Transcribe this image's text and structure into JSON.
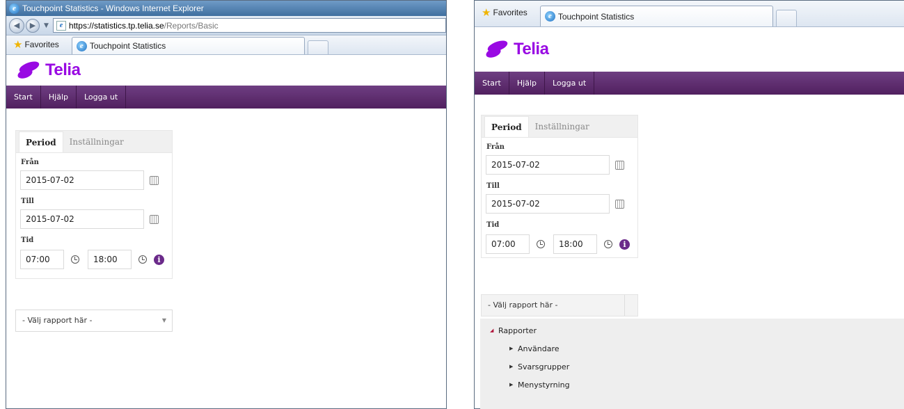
{
  "left_window": {
    "title": "Touchpoint Statistics - Windows Internet Explorer",
    "url_host": "https://statistics.tp.telia.se",
    "url_path": "/Reports/Basic",
    "favorites_label": "Favorites",
    "tab_label": "Touchpoint Statistics"
  },
  "right_window": {
    "favorites_label": "Favorites",
    "tab_label": "Touchpoint Statistics"
  },
  "app": {
    "logo_text": "Telia",
    "nav": [
      "Start",
      "Hjälp",
      "Logga ut"
    ],
    "tabs": {
      "period": "Period",
      "settings": "Inställningar"
    },
    "from_label": "Från",
    "from_value": "2015-07-02",
    "to_label": "Till",
    "to_value": "2015-07-02",
    "time_label": "Tid",
    "time_from": "07:00",
    "time_to": "18:00",
    "info_glyph": "i",
    "report_select": "- Välj rapport här -"
  },
  "tree": {
    "root": "Rapporter",
    "children": [
      "Användare",
      "Svarsgrupper",
      "Menystyrning"
    ]
  },
  "colors": {
    "brand": "#990ae3",
    "navbar": "#5e2b70",
    "info": "#6b2a8a"
  }
}
